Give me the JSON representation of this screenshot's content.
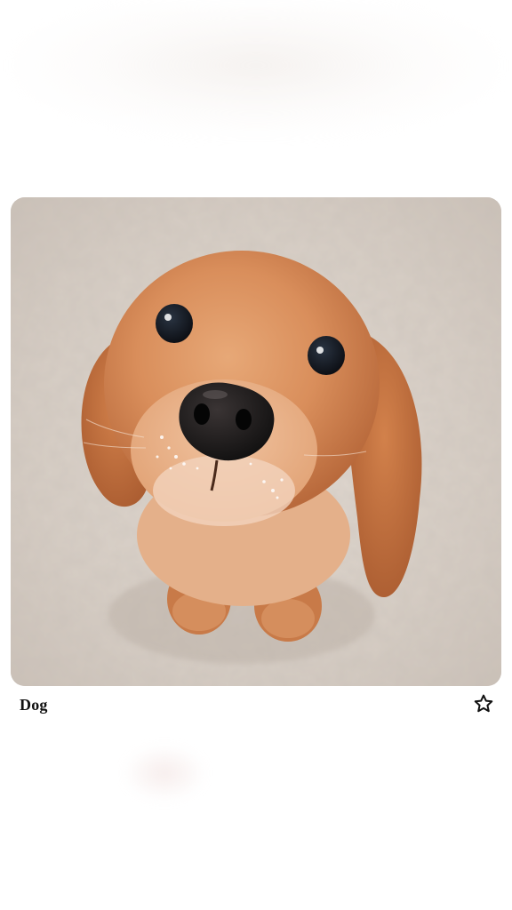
{
  "post": {
    "caption": "Dog",
    "image_icon": "photo-of-puppy",
    "favorite_icon": "star-outline-icon",
    "favorited": false
  },
  "colors": {
    "background": "#ffffff",
    "text": "#111111",
    "star_outline": "#111111"
  }
}
